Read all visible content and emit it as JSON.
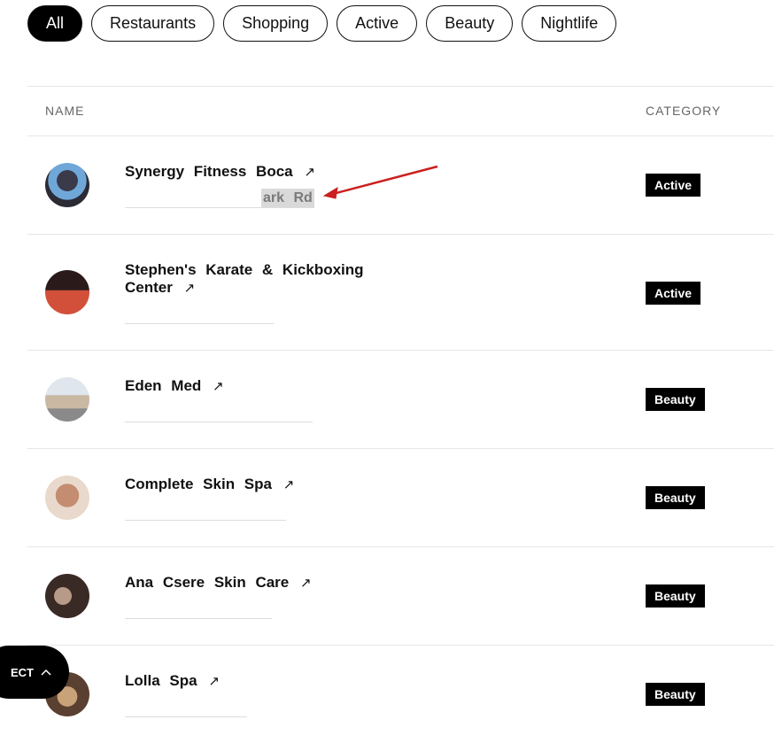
{
  "filters": [
    {
      "label": "All",
      "active": true
    },
    {
      "label": "Restaurants",
      "active": false
    },
    {
      "label": "Shopping",
      "active": false
    },
    {
      "label": "Active",
      "active": false
    },
    {
      "label": "Beauty",
      "active": false
    },
    {
      "label": "Nightlife",
      "active": false
    }
  ],
  "table": {
    "headers": {
      "name": "NAME",
      "category": "CATEGORY"
    },
    "rows": [
      {
        "name": "Synergy Fitness Boca",
        "arrow": "↗",
        "category": "Active",
        "address_fragment": "ark Rd"
      },
      {
        "name": "Stephen's Karate & Kickboxing Center",
        "arrow": "↗",
        "category": "Active"
      },
      {
        "name": "Eden Med",
        "arrow": "↗",
        "category": "Beauty"
      },
      {
        "name": "Complete Skin Spa",
        "arrow": "↗",
        "category": "Beauty"
      },
      {
        "name": "Ana Csere Skin Care",
        "arrow": "↗",
        "category": "Beauty"
      },
      {
        "name": "Lolla Spa",
        "arrow": "↗",
        "category": "Beauty"
      }
    ]
  },
  "select_button": {
    "label": "ECT",
    "icon": "chevron-up-icon"
  },
  "colors": {
    "accent": "#000000",
    "annotation_arrow": "#cc1f1f"
  }
}
